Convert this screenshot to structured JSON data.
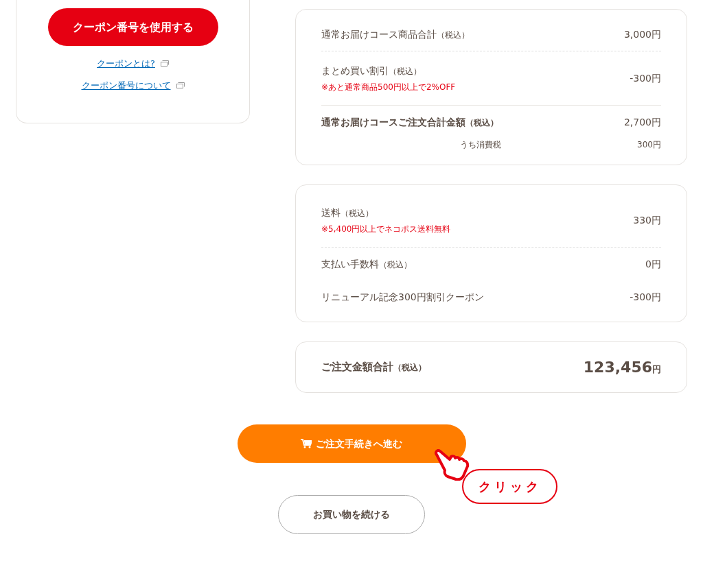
{
  "coupon": {
    "apply_button": "クーポン番号を使用する",
    "links": [
      {
        "label": "クーポンとは?"
      },
      {
        "label": "クーポン番号について"
      }
    ]
  },
  "summary_cards": [
    {
      "rows": [
        {
          "kind": "item",
          "label": "通常お届けコース商品合計",
          "tax_note": "（税込）",
          "value": "3,000円",
          "divider_below": true,
          "divider_dashed": true
        },
        {
          "kind": "item",
          "label": "まとめ買い割引",
          "tax_note": "（税込）",
          "note": "※あと通常商品500円以上で2%OFF",
          "value": "-300円",
          "divider_below": true,
          "divider_dashed": false
        },
        {
          "kind": "total",
          "label": "通常お届けコースご注文合計金額",
          "tax_note": "（税込）",
          "value": "2,700円",
          "divider_below": false
        },
        {
          "kind": "tax",
          "label": "うち消費税",
          "value": "300円",
          "divider_below": false
        }
      ]
    },
    {
      "rows": [
        {
          "kind": "item",
          "label": "送料",
          "tax_note": "（税込）",
          "note": "※5,400円以上でネコポス送料無料",
          "value": "330円",
          "divider_below": true,
          "divider_dashed": true
        },
        {
          "kind": "item",
          "label": "支払い手数料",
          "tax_note": "（税込）",
          "value": "0円",
          "divider_below": false
        },
        {
          "kind": "item",
          "label": "リニューアル記念300円割引クーポン",
          "value": "-300円",
          "divider_below": false
        }
      ]
    }
  ],
  "grand_total": {
    "label": "ご注文金額合計",
    "tax_note": "（税込）",
    "amount": "123,456",
    "unit": "円"
  },
  "checkout_button": "ご注文手続きへ進む",
  "click_callout": "クリック",
  "continue_button": "お買い物を続ける"
}
